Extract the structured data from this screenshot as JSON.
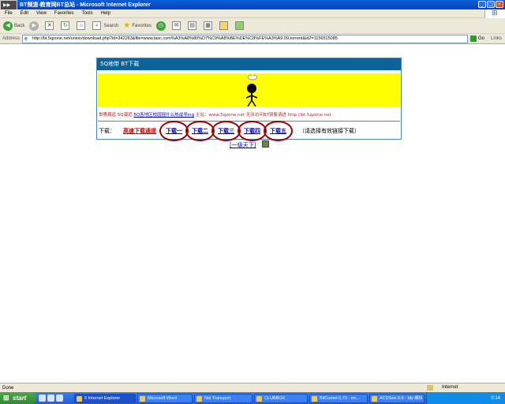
{
  "window": {
    "title": "BT频道-教育网BT总站 - Microsoft Internet Explorer",
    "controls": [
      "_",
      "□",
      "×"
    ]
  },
  "menu": [
    "File",
    "Edit",
    "View",
    "Favorites",
    "Tools",
    "Help"
  ],
  "toolbar": {
    "back_label": "Back",
    "search_label": "Search",
    "favorites_label": "Favorites"
  },
  "address": {
    "label": "Address",
    "url": "http://bt.5qzone.net/union/download.php?id=342263&file=www.taxc.com%A3%A8%80%D7%C9%A8%BE%DE%C8%FE%A3%A9.09.torrent&id2=1156515085",
    "go_label": "Go",
    "links_label": "Links"
  },
  "page": {
    "header": "5Q地带 BT下载",
    "info": {
      "part1": "世界病远 5Q演近",
      "link1": "5Q各地区校园摇什么热战寻ing",
      "part2": "主站：www.5qzone.net 无法访问BT镜像请进",
      "link2": "http://bt.5qzone.net"
    },
    "download_label": "下载：",
    "fast_link": "高速下载通道",
    "links": [
      "下载一",
      "下载二",
      "下载三",
      "下载四",
      "下载五"
    ],
    "hint": "（请选择有效链接下载）",
    "oneclick": "[一级天下]"
  },
  "status": {
    "text": "Done",
    "zone": "Internet"
  },
  "taskbar": {
    "start": "start",
    "tasks": [
      "5 Internet Explorer",
      "Microsoft Word",
      "Net Transport",
      "CLUBBOX",
      "BitComet 0.70 - en...",
      "ACDSee 6.0 - My Pi..."
    ],
    "lang": "EN",
    "clock": "0:14"
  },
  "colors": {
    "header_bg": "#0c6399",
    "banner_bg": "#ffff00",
    "link_blue": "#0000cc",
    "alert_red": "#cc0000",
    "circle_red": "#a00000"
  }
}
